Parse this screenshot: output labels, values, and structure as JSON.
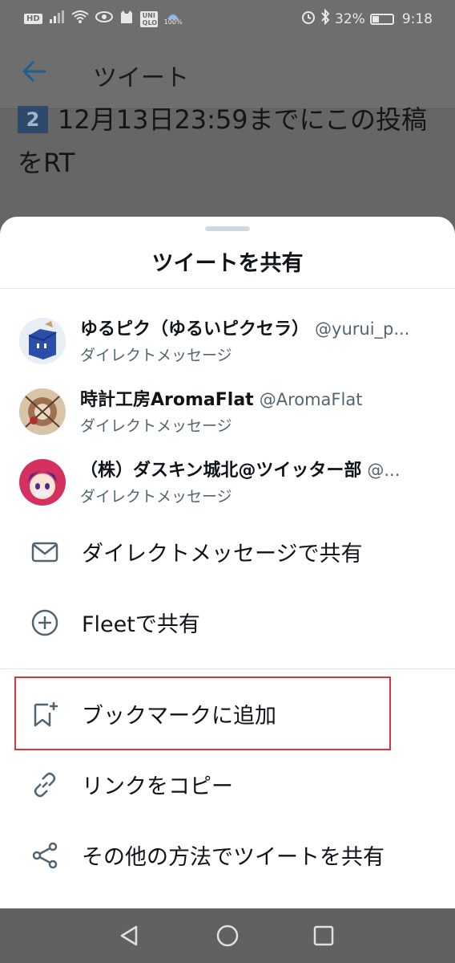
{
  "status_bar": {
    "hd": "HD",
    "uniqlo": "UNI QLO",
    "weather": "100%",
    "battery": "32%",
    "battery_level": 0.32,
    "time": "9:18"
  },
  "app_bar": {
    "title": "ツイート"
  },
  "tweet": {
    "number": "2",
    "text": "12月13日23:59までにこの投稿をRT"
  },
  "share_sheet": {
    "title": "ツイートを共有",
    "recipients": [
      {
        "name": "ゆるピク（ゆるいピクセラ）",
        "handle": "@yurui_p...",
        "subtitle": "ダイレクトメッセージ"
      },
      {
        "name": "時計工房AromaFlat",
        "handle": "@AromaFlat",
        "subtitle": "ダイレクトメッセージ"
      },
      {
        "name": "（株）ダスキン城北@ツイッター部",
        "handle": "@...",
        "subtitle": "ダイレクトメッセージ"
      }
    ],
    "actions": {
      "dm": "ダイレクトメッセージで共有",
      "fleet": "Fleetで共有",
      "bookmark": "ブックマークに追加",
      "copy_link": "リンクをコピー",
      "other": "その他の方法でツイートを共有"
    }
  },
  "colors": {
    "accent": "#1d9bf0",
    "highlight": "#d9363e",
    "icon": "#536471"
  }
}
